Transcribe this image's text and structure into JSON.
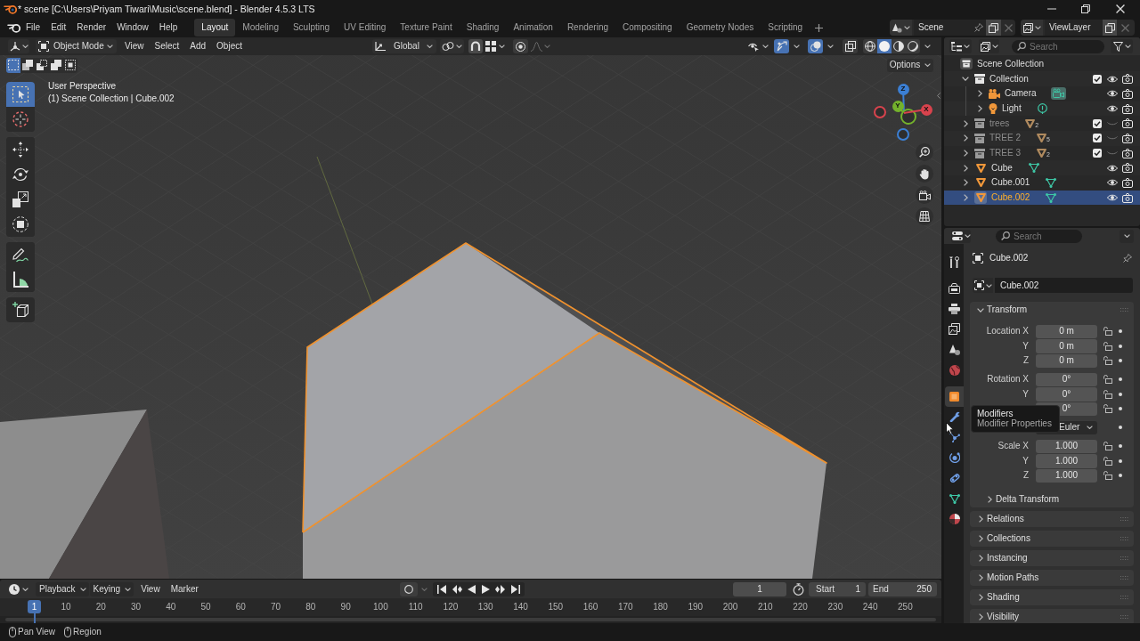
{
  "window": {
    "title": "* scene [C:\\Users\\Priyam Tiwari\\Music\\scene.blend] - Blender 4.5.3 LTS"
  },
  "menu_bar": [
    "File",
    "Edit",
    "Render",
    "Window",
    "Help"
  ],
  "workspace_tabs": [
    {
      "label": "Layout",
      "selected": true
    },
    {
      "label": "Modeling",
      "selected": false
    },
    {
      "label": "Sculpting",
      "selected": false
    },
    {
      "label": "UV Editing",
      "selected": false
    },
    {
      "label": "Texture Paint",
      "selected": false
    },
    {
      "label": "Shading",
      "selected": false
    },
    {
      "label": "Animation",
      "selected": false
    },
    {
      "label": "Rendering",
      "selected": false
    },
    {
      "label": "Compositing",
      "selected": false
    },
    {
      "label": "Geometry Nodes",
      "selected": false
    },
    {
      "label": "Scripting",
      "selected": false
    }
  ],
  "scene_selector": {
    "value": "Scene"
  },
  "view_layer_selector": {
    "value": "ViewLayer"
  },
  "viewport": {
    "header": {
      "mode": "Object Mode",
      "menus": [
        "View",
        "Select",
        "Add",
        "Object"
      ],
      "orientation": "Global",
      "toggles": [
        {
          "kind": "gizmos",
          "on": true
        },
        {
          "kind": "overlays",
          "on": true
        },
        {
          "kind": "xray",
          "on": false
        }
      ],
      "shading": [
        {
          "kind": "wireframe",
          "selected": false
        },
        {
          "kind": "solid",
          "selected": true
        },
        {
          "kind": "material",
          "selected": false
        },
        {
          "kind": "rendered",
          "selected": false
        }
      ]
    },
    "select_modes": [
      {
        "kind": "set",
        "selected": true
      },
      {
        "kind": "extend",
        "selected": false
      },
      {
        "kind": "subtract",
        "selected": false
      },
      {
        "kind": "invert",
        "selected": false
      },
      {
        "kind": "intersect",
        "selected": false
      }
    ],
    "options": "Options",
    "view_name": "User Perspective",
    "context": "(1) Scene Collection | Cube.002",
    "tool_groups": [
      {
        "tools": [
          {
            "kind": "select-box",
            "selected": true
          },
          {
            "kind": "cursor",
            "selected": false
          }
        ]
      },
      {
        "tools": [
          {
            "kind": "move",
            "selected": false
          },
          {
            "kind": "rotate",
            "selected": false
          },
          {
            "kind": "scale",
            "selected": false
          },
          {
            "kind": "transform",
            "selected": false
          }
        ]
      },
      {
        "tools": [
          {
            "kind": "annotate",
            "selected": false
          },
          {
            "kind": "measure",
            "selected": false
          }
        ]
      },
      {
        "tools": [
          {
            "kind": "add-cube",
            "selected": false
          }
        ]
      }
    ],
    "gizmo_axes": [
      {
        "label": "Z",
        "color": "#3b7fd4"
      },
      {
        "label": "Y",
        "color": "#74b22c"
      },
      {
        "label": "X",
        "color": "#d8434d"
      }
    ]
  },
  "timeline": {
    "menus": [
      "Playback",
      "Keying",
      "View",
      "Marker"
    ],
    "current_frame": "1",
    "start": {
      "label": "Start",
      "value": "1"
    },
    "end": {
      "label": "End",
      "value": "250"
    },
    "playhead": "1",
    "ruler_labels": [
      "10",
      "20",
      "30",
      "40",
      "50",
      "60",
      "70",
      "80",
      "90",
      "100",
      "110",
      "120",
      "130",
      "140",
      "150",
      "160",
      "170",
      "180",
      "190",
      "200",
      "210",
      "220",
      "230",
      "240",
      "250"
    ]
  },
  "outliner": {
    "search": {
      "placeholder": "Search"
    },
    "root": {
      "name": "Scene Collection",
      "children": [
        {
          "name": "Collection",
          "kind": "collection",
          "expanded": true,
          "checked": true,
          "visible": true,
          "selected": false,
          "children": [
            {
              "name": "Camera",
              "kind": "camera",
              "expanded": false,
              "visible": true,
              "selected": false
            },
            {
              "name": "Light",
              "kind": "light",
              "expanded": false,
              "visible": true,
              "selected": false
            }
          ]
        },
        {
          "name": "trees",
          "kind": "collection",
          "expanded": false,
          "checked": true,
          "visible": false,
          "selected": false,
          "object_count": "2"
        },
        {
          "name": "TREE 2",
          "kind": "collection",
          "expanded": false,
          "checked": true,
          "visible": false,
          "selected": false,
          "object_count": "5"
        },
        {
          "name": "TREE 3",
          "kind": "collection",
          "expanded": false,
          "checked": true,
          "visible": false,
          "selected": false,
          "object_count": "2"
        },
        {
          "name": "Cube",
          "kind": "mesh",
          "expanded": false,
          "visible": true,
          "selected": false
        },
        {
          "name": "Cube.001",
          "kind": "mesh",
          "expanded": false,
          "visible": true,
          "selected": false
        },
        {
          "name": "Cube.002",
          "kind": "mesh",
          "expanded": false,
          "visible": true,
          "selected": true
        }
      ]
    }
  },
  "properties": {
    "search": {
      "placeholder": "Search"
    },
    "tab_groups": [
      {
        "tabs": [
          {
            "kind": "tool",
            "selected": false
          }
        ]
      },
      {
        "tabs": [
          {
            "kind": "render",
            "selected": false
          },
          {
            "kind": "output",
            "selected": false
          },
          {
            "kind": "view-layer",
            "selected": false
          },
          {
            "kind": "scene",
            "selected": false
          },
          {
            "kind": "world",
            "selected": false
          }
        ]
      },
      {
        "tabs": [
          {
            "kind": "object",
            "selected": true
          },
          {
            "kind": "modifiers",
            "selected": false
          },
          {
            "kind": "particles",
            "selected": false
          },
          {
            "kind": "physics",
            "selected": false
          },
          {
            "kind": "constraints",
            "selected": false
          },
          {
            "kind": "data",
            "selected": false
          },
          {
            "kind": "material",
            "selected": false
          }
        ]
      }
    ],
    "tooltip": {
      "title": "Modifiers",
      "description": "Modifier Properties"
    },
    "context_title": "Cube.002",
    "object_name": "Cube.002",
    "panels": [
      {
        "title": "Transform",
        "expanded": true,
        "groups": [
          {
            "rows": [
              {
                "kind": "number",
                "label": "Location X",
                "value": "0 m"
              },
              {
                "kind": "number",
                "label": "Y",
                "value": "0 m"
              },
              {
                "kind": "number",
                "label": "Z",
                "value": "0 m"
              }
            ]
          },
          {
            "rows": [
              {
                "kind": "number",
                "label": "Rotation X",
                "value": "0°"
              },
              {
                "kind": "number",
                "label": "Y",
                "value": "0°"
              },
              {
                "kind": "number",
                "value": "0°"
              }
            ]
          },
          {
            "rows": [
              {
                "kind": "dropdown",
                "value": "Euler"
              }
            ]
          },
          {
            "rows": [
              {
                "kind": "number",
                "label": "Scale X",
                "value": "1.000"
              },
              {
                "kind": "number",
                "label": "Y",
                "value": "1.000"
              },
              {
                "kind": "number",
                "label": "Z",
                "value": "1.000"
              }
            ]
          }
        ],
        "subpanels": [
          {
            "title": "Delta Transform",
            "expanded": false
          }
        ]
      },
      {
        "title": "Relations",
        "expanded": false
      },
      {
        "title": "Collections",
        "expanded": false
      },
      {
        "title": "Instancing",
        "expanded": false
      },
      {
        "title": "Motion Paths",
        "expanded": false
      },
      {
        "title": "Shading",
        "expanded": false
      },
      {
        "title": "Visibility",
        "expanded": false
      }
    ]
  },
  "status_bar": {
    "hints": [
      {
        "label": "Pan View"
      },
      {
        "label": "Region"
      }
    ]
  }
}
